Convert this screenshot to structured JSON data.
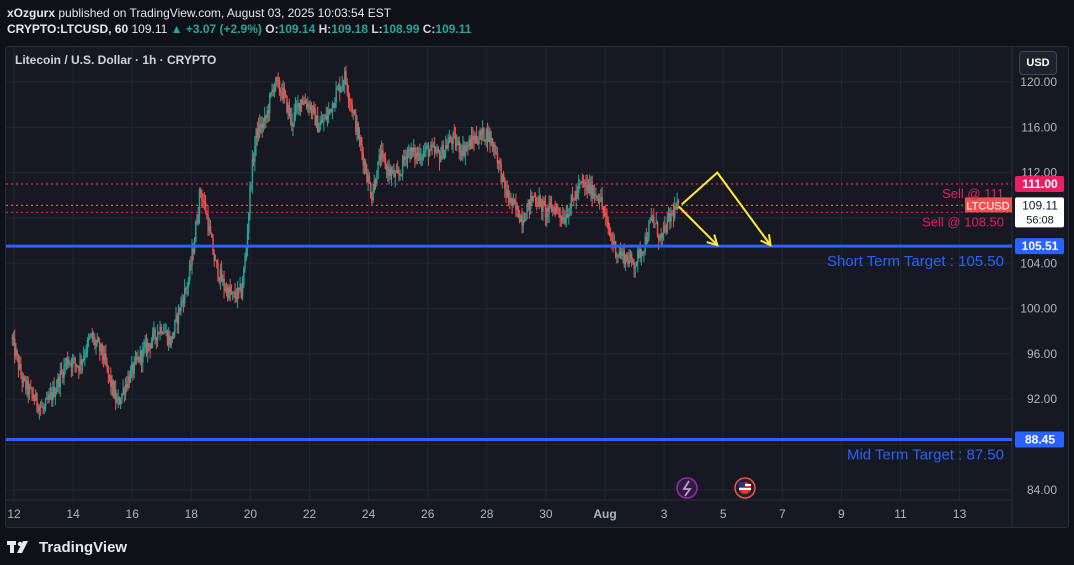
{
  "header": {
    "publisher": "xOzgurx",
    "publish_text": "published on TradingView.com, August 03, 2025 10:03:54 EST",
    "symbol": "CRYPTO:LTCUSD, 60",
    "last": "109.11",
    "change": "▲ +3.07 (+2.9%)",
    "o_label": "O:",
    "o_value": "109.14",
    "h_label": "H:",
    "h_value": "109.18",
    "l_label": "L:",
    "l_value": "108.99",
    "c_label": "C:",
    "c_value": "109.11"
  },
  "chart_title": "Litecoin / U.S. Dollar · 1h · CRYPTO",
  "currency_button": "USD",
  "footer": {
    "brand": "TradingView"
  },
  "colors": {
    "background": "#161922",
    "up": "#26a69a",
    "down": "#ef5350",
    "blue_line": "#2962ff",
    "sell_line": "#e91e63",
    "arrow": "#ffeb3b"
  },
  "chart_data": {
    "type": "candlestick",
    "interval": "1h",
    "y_range": [
      82.5,
      122.5
    ],
    "y_ticks": [
      84,
      88,
      92,
      96,
      100,
      104,
      108,
      112,
      116,
      120
    ],
    "y_tick_labels_visible": [
      "84.00",
      "92.00",
      "96.00",
      "100.00",
      "104.00",
      "112.00",
      "116.00",
      "120.00"
    ],
    "x_ticks": [
      {
        "label": "12",
        "day": 12
      },
      {
        "label": "14",
        "day": 14
      },
      {
        "label": "16",
        "day": 16
      },
      {
        "label": "18",
        "day": 18
      },
      {
        "label": "20",
        "day": 20
      },
      {
        "label": "22",
        "day": 22
      },
      {
        "label": "24",
        "day": 24
      },
      {
        "label": "26",
        "day": 26
      },
      {
        "label": "28",
        "day": 28
      },
      {
        "label": "30",
        "day": 30
      },
      {
        "label": "Aug",
        "day": 32
      },
      {
        "label": "3",
        "day": 34
      },
      {
        "label": "5",
        "day": 36
      },
      {
        "label": "7",
        "day": 38
      },
      {
        "label": "9",
        "day": 40
      },
      {
        "label": "11",
        "day": 42
      },
      {
        "label": "13",
        "day": 44
      }
    ],
    "price_path": [
      [
        11.9,
        97.5
      ],
      [
        12.3,
        93.5
      ],
      [
        12.7,
        92.0
      ],
      [
        13.0,
        91.0
      ],
      [
        13.4,
        93.0
      ],
      [
        13.8,
        95.5
      ],
      [
        14.2,
        95.0
      ],
      [
        14.6,
        97.5
      ],
      [
        15.0,
        96.0
      ],
      [
        15.2,
        94.0
      ],
      [
        15.5,
        91.5
      ],
      [
        15.8,
        93.5
      ],
      [
        16.2,
        95.5
      ],
      [
        16.6,
        97.0
      ],
      [
        17.0,
        98.5
      ],
      [
        17.3,
        97.0
      ],
      [
        17.6,
        100.0
      ],
      [
        17.9,
        102.5
      ],
      [
        18.1,
        106.0
      ],
      [
        18.3,
        110.5
      ],
      [
        18.5,
        108.5
      ],
      [
        18.8,
        104.0
      ],
      [
        19.1,
        102.0
      ],
      [
        19.4,
        101.0
      ],
      [
        19.7,
        101.5
      ],
      [
        19.85,
        105.0
      ],
      [
        20.0,
        111.0
      ],
      [
        20.2,
        115.5
      ],
      [
        20.5,
        116.5
      ],
      [
        20.8,
        120.0
      ],
      [
        21.1,
        119.0
      ],
      [
        21.4,
        116.5
      ],
      [
        21.7,
        118.5
      ],
      [
        22.0,
        118.0
      ],
      [
        22.3,
        116.0
      ],
      [
        22.6,
        117.0
      ],
      [
        22.9,
        119.0
      ],
      [
        23.2,
        120.5
      ],
      [
        23.5,
        117.0
      ],
      [
        23.8,
        113.5
      ],
      [
        24.1,
        110.0
      ],
      [
        24.4,
        113.5
      ],
      [
        24.7,
        112.0
      ],
      [
        25.0,
        111.5
      ],
      [
        25.3,
        114.0
      ],
      [
        25.6,
        113.5
      ],
      [
        26.0,
        114.0
      ],
      [
        26.4,
        113.5
      ],
      [
        26.8,
        115.0
      ],
      [
        27.2,
        114.0
      ],
      [
        27.6,
        115.0
      ],
      [
        28.0,
        115.5
      ],
      [
        28.3,
        114.0
      ],
      [
        28.6,
        110.5
      ],
      [
        28.9,
        109.0
      ],
      [
        29.2,
        108.0
      ],
      [
        29.6,
        110.0
      ],
      [
        30.0,
        108.5
      ],
      [
        30.3,
        109.0
      ],
      [
        30.6,
        108.0
      ],
      [
        30.9,
        109.5
      ],
      [
        31.2,
        111.0
      ],
      [
        31.5,
        110.5
      ],
      [
        31.8,
        110.0
      ],
      [
        32.1,
        107.0
      ],
      [
        32.4,
        105.0
      ],
      [
        32.7,
        104.5
      ],
      [
        33.0,
        104.0
      ],
      [
        33.3,
        105.5
      ],
      [
        33.6,
        108.0
      ],
      [
        33.9,
        106.0
      ],
      [
        34.1,
        107.5
      ],
      [
        34.3,
        108.5
      ],
      [
        34.5,
        109.1
      ]
    ],
    "horizontal_lines": [
      {
        "name": "sell_111",
        "price": 111.0,
        "style": "dotted",
        "color": "#e91e63",
        "label": "Sell @ 111",
        "tag": "111.00"
      },
      {
        "name": "sell_108_5",
        "price": 108.5,
        "style": "dotted",
        "color": "#e91e63",
        "label": "Sell @ 108.50",
        "tag": "108.50"
      },
      {
        "name": "last_price",
        "price": 109.11,
        "style": "dotted",
        "color": "#ef5350",
        "tag": "109.11"
      },
      {
        "name": "short_term_target",
        "price": 105.51,
        "style": "solid",
        "color": "#2962ff",
        "label": "Short Term Target : 105.50",
        "tag": "105.51"
      },
      {
        "name": "mid_term_target",
        "price": 88.45,
        "style": "solid",
        "color": "#2962ff",
        "label": "Mid Term Target : 87.50",
        "tag": "88.45"
      }
    ],
    "last_price_tag": {
      "symbol": "LTCUSD",
      "price": "109.11",
      "countdown": "56:08"
    },
    "projection_arrows": [
      {
        "from": [
          34.5,
          109.0
        ],
        "to": [
          35.8,
          105.6
        ]
      },
      {
        "from": [
          34.6,
          109.2
        ],
        "via": [
          35.8,
          112.0
        ],
        "to": [
          37.6,
          105.6
        ]
      }
    ]
  }
}
